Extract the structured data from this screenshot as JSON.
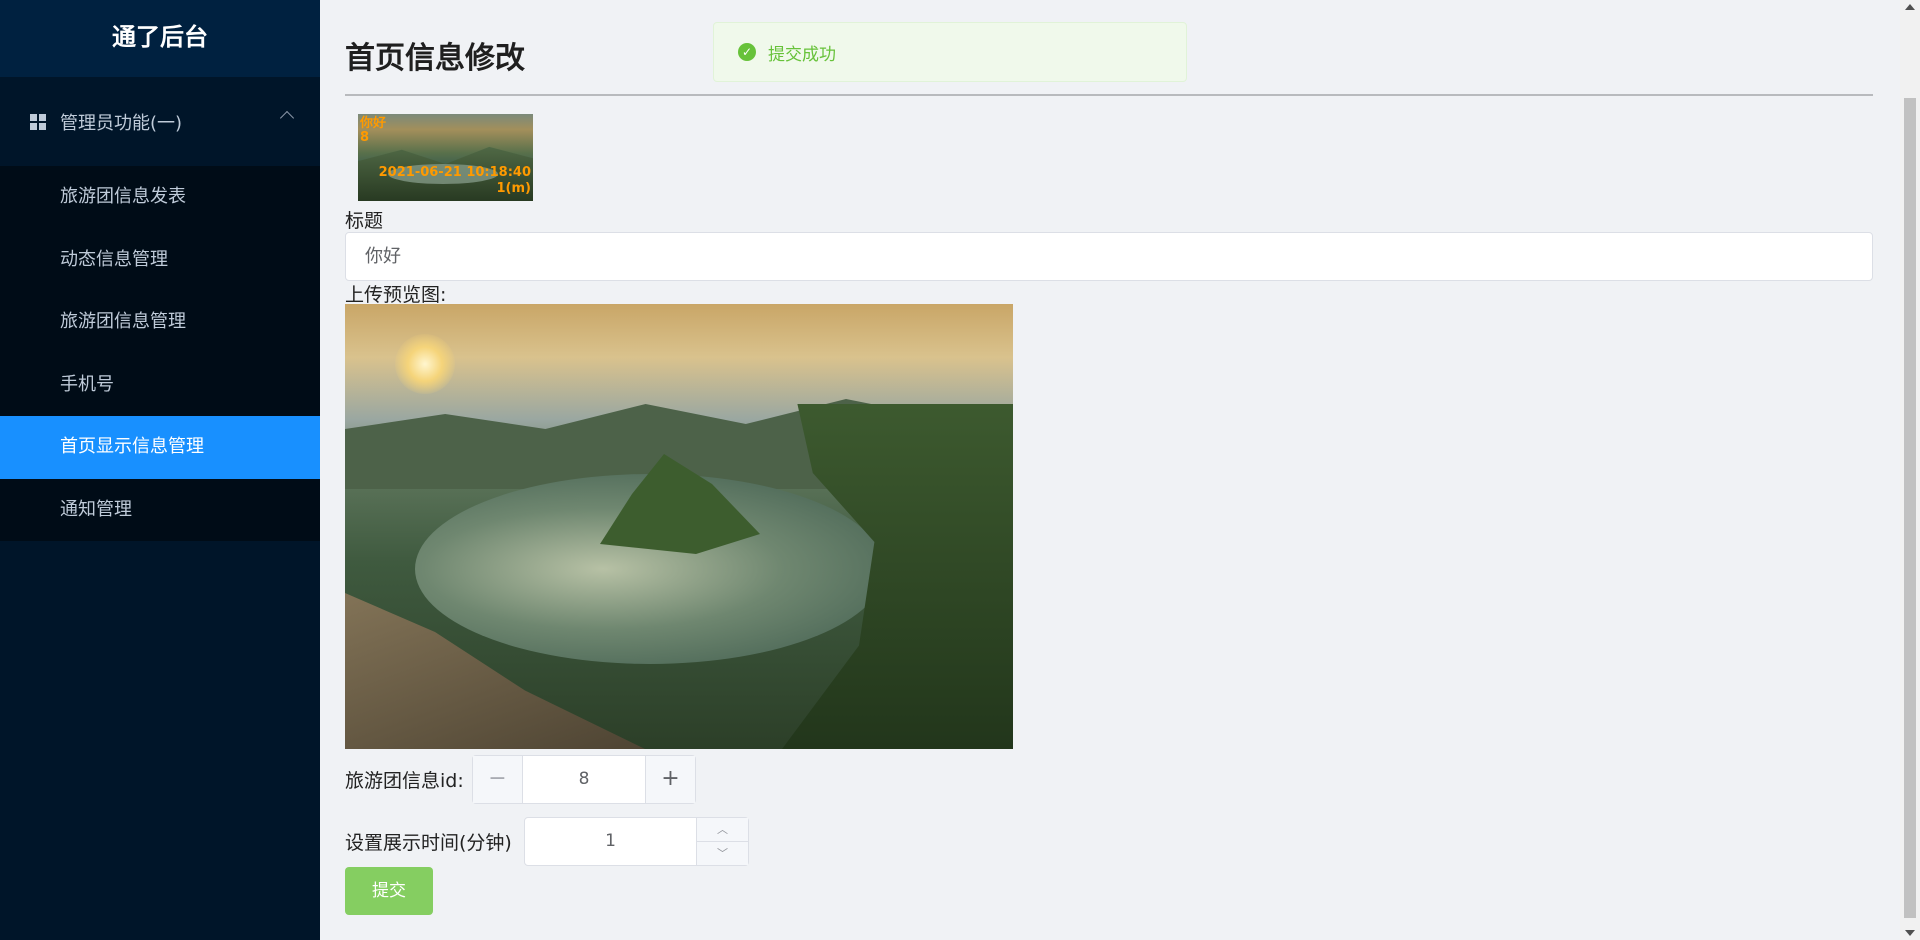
{
  "sidebar": {
    "brand": "通了后台",
    "group": {
      "label": "管理员功能(一)",
      "icon": "grid-icon"
    },
    "items": [
      {
        "label": "旅游团信息发表"
      },
      {
        "label": "动态信息管理"
      },
      {
        "label": "旅游团信息管理"
      },
      {
        "label": "手机号"
      },
      {
        "label": "首页显示信息管理",
        "active": true
      },
      {
        "label": "通知管理"
      }
    ]
  },
  "page": {
    "title": "首页信息修改",
    "toast": {
      "text": "提交成功",
      "icon": "check-circle-icon",
      "color": "#67c23a"
    }
  },
  "thumbnail": {
    "title": "你好",
    "id": "8",
    "datetime": "2021-06-21 10:18:40",
    "duration": "1(m)"
  },
  "form": {
    "title_label": "标题",
    "title_value": "你好",
    "preview_label": "上传预览图:",
    "tour_id_label": "旅游团信息id:",
    "tour_id_value": "8",
    "minus": "−",
    "plus": "+",
    "duration_label": "设置展示时间(分钟)",
    "duration_value": "1",
    "submit_label": "提交"
  },
  "colors": {
    "sidebar_bg": "#001529",
    "active_item": "#1890ff",
    "submit_bg": "#85ce61"
  }
}
